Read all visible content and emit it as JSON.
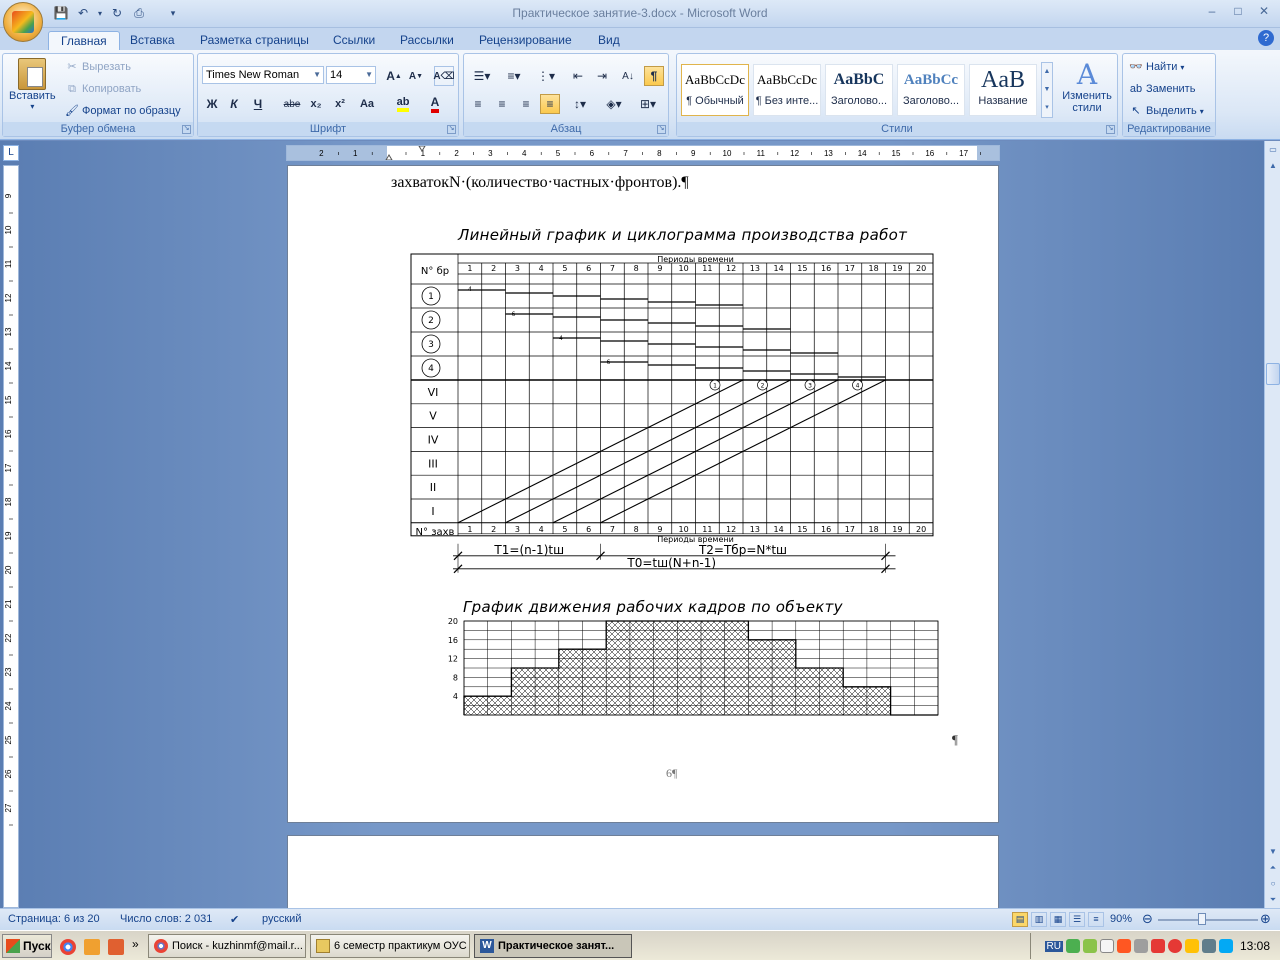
{
  "window": {
    "title": "Практическое занятие-3.docx - Microsoft Word",
    "minimize": "–",
    "maximize": "□",
    "close": "✕"
  },
  "tabs": [
    {
      "label": "Главная",
      "active": true
    },
    {
      "label": "Вставка"
    },
    {
      "label": "Разметка страницы"
    },
    {
      "label": "Ссылки"
    },
    {
      "label": "Рассылки"
    },
    {
      "label": "Рецензирование"
    },
    {
      "label": "Вид"
    }
  ],
  "ribbon": {
    "clipboard": {
      "label": "Буфер обмена",
      "paste": "Вставить",
      "cut": "Вырезать",
      "copy": "Копировать",
      "format_painter": "Формат по образцу"
    },
    "font": {
      "label": "Шрифт",
      "font_name": "Times New Roman",
      "font_size": "14",
      "bold": "Ж",
      "italic": "К",
      "underline": "Ч",
      "strike": "abe",
      "subscript": "x₂",
      "superscript": "x²",
      "change_case": "Aa",
      "grow": "A",
      "shrink": "A"
    },
    "paragraph": {
      "label": "Абзац",
      "show_marks": "¶"
    },
    "styles": {
      "label": "Стили",
      "items": [
        {
          "preview": "AaBbCcDc",
          "name": "¶ Обычный"
        },
        {
          "preview": "AaBbCcDc",
          "name": "¶ Без инте..."
        },
        {
          "preview": "AaBbC",
          "name": "Заголово..."
        },
        {
          "preview": "AaBbCc",
          "name": "Заголово..."
        },
        {
          "preview": "AaB",
          "name": "Название"
        }
      ],
      "change_styles": "Изменить стили"
    },
    "editing": {
      "label": "Редактирование",
      "find": "Найти",
      "replace": "Заменить",
      "select": "Выделить"
    }
  },
  "document": {
    "paragraph_text": "захватокN·(количество·частных·фронтов).¶",
    "drawing_title_1": "Линейный график и циклограмма производства работ",
    "drawing_title_2": "График движения рабочих кадров по объекту",
    "header_brigade": "N° бр",
    "header_periods": "Периоды времени",
    "footer_zakhv": "N° захв",
    "period_numbers": [
      "1",
      "2",
      "3",
      "4",
      "5",
      "6",
      "7",
      "8",
      "9",
      "10",
      "11",
      "12",
      "13",
      "14",
      "15",
      "16",
      "17",
      "18",
      "19",
      "20"
    ],
    "brigades": [
      "1",
      "2",
      "3",
      "4"
    ],
    "zakhvatki": [
      "VI",
      "V",
      "IV",
      "III",
      "II",
      "I"
    ],
    "line_labels": [
      "1",
      "2",
      "3",
      "4"
    ],
    "bar_labels": [
      "4",
      "6",
      "4",
      "6"
    ],
    "t1": "T1=(n-1)tш",
    "t2": "T2=Tбр=N*tш",
    "t0": "T0=tш(N+n-1)",
    "workers_axis": [
      "20",
      "16",
      "12",
      "8",
      "4"
    ],
    "page_number": "6¶",
    "end_pilcrow": "¶"
  },
  "chart_data": {
    "type": "bar",
    "title": "График движения рабочих кадров по объекту",
    "categories": [
      "1",
      "2",
      "3",
      "4",
      "5",
      "6",
      "7",
      "8",
      "9",
      "10",
      "11",
      "12",
      "13",
      "14",
      "15",
      "16",
      "17",
      "18",
      "19",
      "20"
    ],
    "values": [
      4,
      4,
      10,
      10,
      14,
      14,
      20,
      20,
      20,
      20,
      20,
      20,
      16,
      16,
      10,
      10,
      6,
      6,
      0,
      0
    ],
    "ylim": [
      0,
      20
    ],
    "yticks": [
      4,
      8,
      12,
      16,
      20
    ],
    "grid": true
  },
  "statusbar": {
    "page": "Страница: 6 из 20",
    "words": "Число слов: 2 031",
    "language": "русский",
    "zoom": "90%"
  },
  "taskbar": {
    "start": "Пуск",
    "tasks": [
      {
        "label": "Поиск - kuzhinmf@mail.r..."
      },
      {
        "label": "6 семестр практикум ОУС"
      },
      {
        "label": "Практическое занят...",
        "active": true
      }
    ],
    "lang": "RU",
    "time": "13:08"
  },
  "colors": {
    "ribbon_text": "#15428b",
    "doc_background": "#7798c8",
    "active_toggle": "#fbc94e"
  }
}
